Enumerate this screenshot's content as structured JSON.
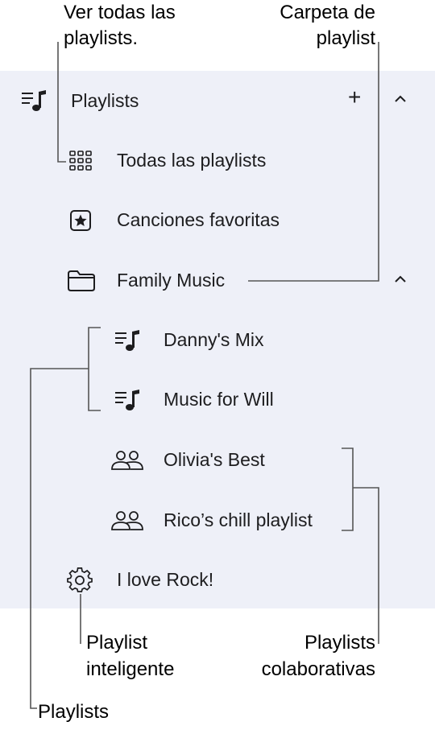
{
  "sidebar": {
    "section_title": "Playlists",
    "add_label": "+",
    "items": [
      {
        "label": "Todas las playlists",
        "icon": "grid-icon"
      },
      {
        "label": "Canciones favoritas",
        "icon": "star-icon"
      },
      {
        "label": "Family Music",
        "icon": "folder-icon"
      },
      {
        "label": "Danny's Mix",
        "icon": "playlist-icon"
      },
      {
        "label": "Music for Will",
        "icon": "playlist-icon"
      },
      {
        "label": "Olivia's Best",
        "icon": "people-icon"
      },
      {
        "label": "Rico’s chill playlist",
        "icon": "people-icon"
      },
      {
        "label": "I love Rock!",
        "icon": "gear-icon"
      }
    ]
  },
  "callouts": {
    "all_playlists_line1": "Ver todas las",
    "all_playlists_line2": "playlists.",
    "folder_line1": "Carpeta de",
    "folder_line2": "playlist",
    "smart_line1": "Playlist",
    "smart_line2": "inteligente",
    "collab_line1": "Playlists",
    "collab_line2": "colaborativas",
    "playlists": "Playlists"
  },
  "colors": {
    "panel_bg": "#eef0f8",
    "text": "#1d1d1f",
    "leader": "#555555"
  }
}
